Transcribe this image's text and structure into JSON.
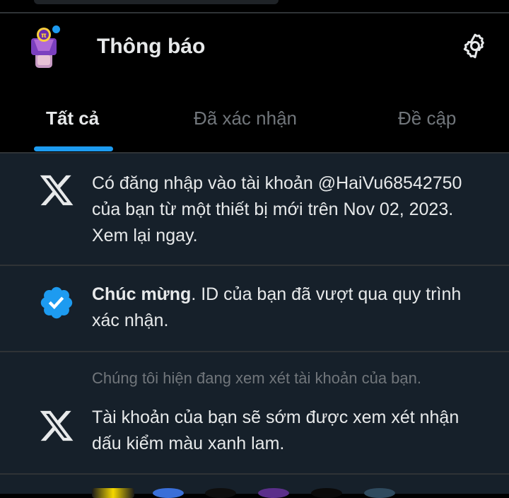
{
  "header": {
    "title": "Thông báo",
    "avatar_icon": "pi-network-avatar-icon",
    "settings_icon": "gear-icon"
  },
  "tabs": [
    {
      "label": "Tất cả",
      "active": true
    },
    {
      "label": "Đã xác nhận",
      "active": false
    },
    {
      "label": "Đề cập",
      "active": false
    }
  ],
  "notifications": [
    {
      "icon": "x-logo-icon",
      "text": "Có đăng nhập vào tài khoản @HaiVu68542750 của bạn từ một thiết bị mới trên Nov 02, 2023. Xem lại ngay."
    },
    {
      "icon": "verified-badge-icon",
      "bold": "Chúc mừng",
      "text": ".  ID của bạn đã vượt qua quy trình xác nhận."
    },
    {
      "icon": "x-logo-icon",
      "context": "Chúng tôi hiện đang xem xét tài khoản của bạn.",
      "text": "Tài khoản của bạn sẽ sớm được xem xét nhận dấu kiểm màu xanh lam."
    }
  ],
  "colors": {
    "accent": "#1d9bf0",
    "background": "#000000",
    "feed_background": "#16202a",
    "text_primary": "#e7e9ea",
    "text_secondary": "#71767b",
    "divider": "#2f3336"
  }
}
